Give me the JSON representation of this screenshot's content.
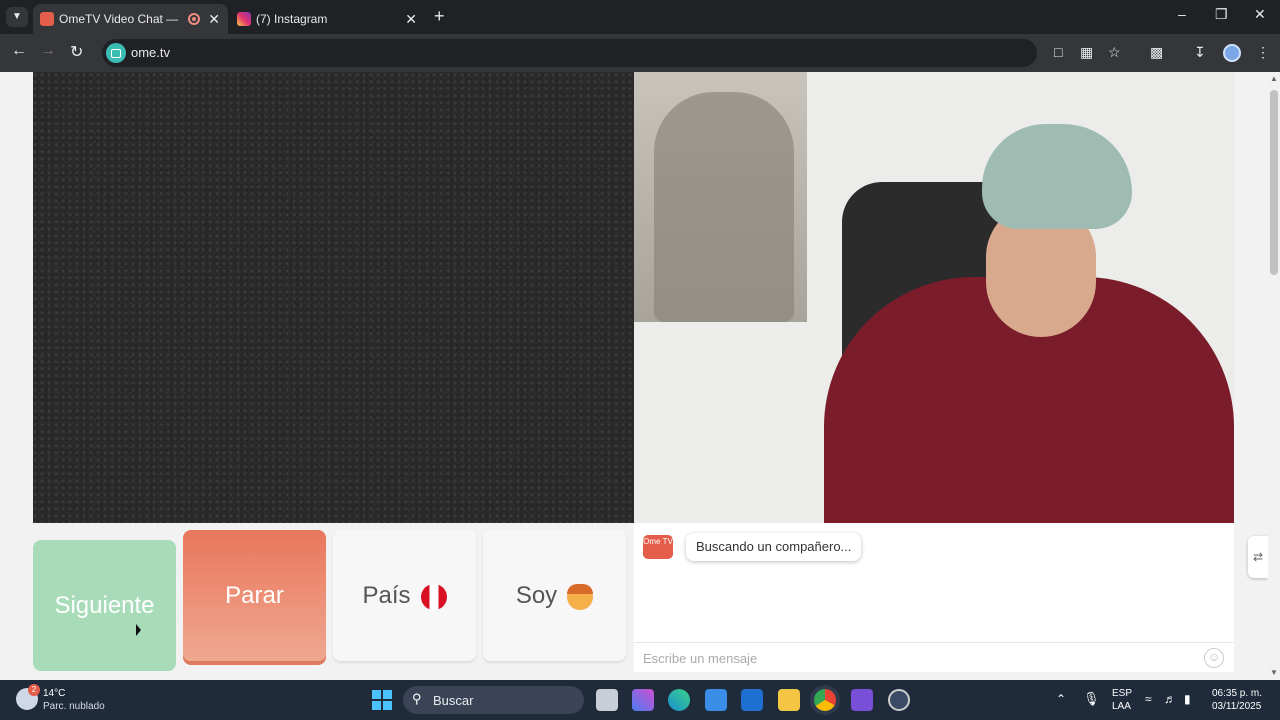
{
  "browser": {
    "tabs": [
      {
        "title": "OmeTV Video Chat — Ome",
        "active": true
      },
      {
        "title": "(7) Instagram",
        "active": false
      }
    ],
    "url": "ome.tv"
  },
  "buttons": {
    "next": "Siguiente",
    "stop": "Parar",
    "country": "País",
    "gender": "Soy"
  },
  "chat": {
    "logo": "Ome TV",
    "status": "Buscando un compañero...",
    "input_placeholder": "Escribe un mensaje"
  },
  "taskbar": {
    "weather": {
      "temp": "14°C",
      "condition": "Parc. nublado",
      "badge": "2"
    },
    "search_label": "Buscar",
    "language": {
      "code": "ESP",
      "layout": "LAA"
    },
    "clock": {
      "time": "06:35 p. m.",
      "date": "03/11/2025"
    }
  },
  "colors": {
    "next": "#a8dcb8",
    "stop": "#e8765c",
    "accent": "#3cbdb3"
  }
}
